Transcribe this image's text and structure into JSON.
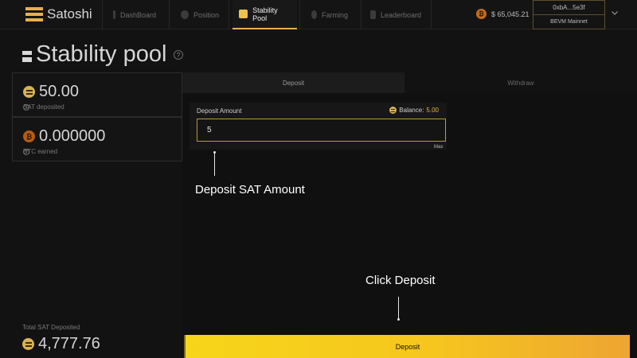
{
  "nav": {
    "brand": "Satoshi",
    "items": [
      {
        "label": "DashBoard",
        "icon": "dashboard-icon"
      },
      {
        "label": "Position",
        "icon": "position-icon"
      },
      {
        "label": "Stability Pool",
        "icon": "stability-pool-icon",
        "active": true
      },
      {
        "label": "Farming",
        "icon": "farming-icon"
      },
      {
        "label": "Leaderboard",
        "icon": "leaderboard-icon"
      }
    ],
    "btc_price": "$ 65,045.21",
    "wallet_address": "0xbA...5e3f",
    "network": "BEVM Mainnet"
  },
  "page": {
    "title": "Stability pool"
  },
  "stats": {
    "sat_deposited_value": "50.00",
    "sat_deposited_label": "SAT deposited",
    "btc_earned_value": "0.000000",
    "btc_earned_label": "BTC earned",
    "total_label": "Total SAT Deposited",
    "total_value": "4,777.76"
  },
  "tabs": {
    "deposit": "Deposit",
    "withdraw": "Withdraw"
  },
  "form": {
    "label": "Deposit Amount",
    "balance_label": "Balance:",
    "balance_value": "5.00",
    "amount_value": "5",
    "max_label": "Max",
    "submit_label": "Deposit"
  },
  "annotations": {
    "deposit_amount": "Deposit SAT Amount",
    "click_deposit": "Click Deposit"
  },
  "colors": {
    "accent": "#e7b04c",
    "button_start": "#f7d51a",
    "button_end": "#eda532",
    "background": "#121212"
  }
}
